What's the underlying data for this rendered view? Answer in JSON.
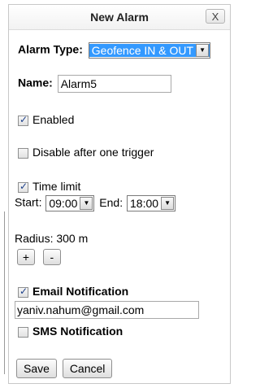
{
  "dialog": {
    "title": "New Alarm",
    "close_label": "X"
  },
  "alarm_type": {
    "label": "Alarm Type:",
    "value": "Geofence IN & OUT"
  },
  "name": {
    "label": "Name:",
    "value": "Alarm5"
  },
  "enabled": {
    "label": "Enabled",
    "checked": true
  },
  "disable_after": {
    "label": "Disable after one trigger",
    "checked": false
  },
  "time_limit": {
    "label": "Time limit",
    "checked": true,
    "start_label": "Start:",
    "start_value": "09:00",
    "end_label": "End:",
    "end_value": "18:00"
  },
  "radius": {
    "label": "Radius: 300 m",
    "plus_label": "+",
    "minus_label": "-"
  },
  "email_notification": {
    "label": "Email Notification",
    "checked": true,
    "email_value": "yaniv.nahum@gmail.com"
  },
  "sms_notification": {
    "label": "SMS Notification",
    "checked": false
  },
  "actions": {
    "save_label": "Save",
    "cancel_label": "Cancel"
  }
}
